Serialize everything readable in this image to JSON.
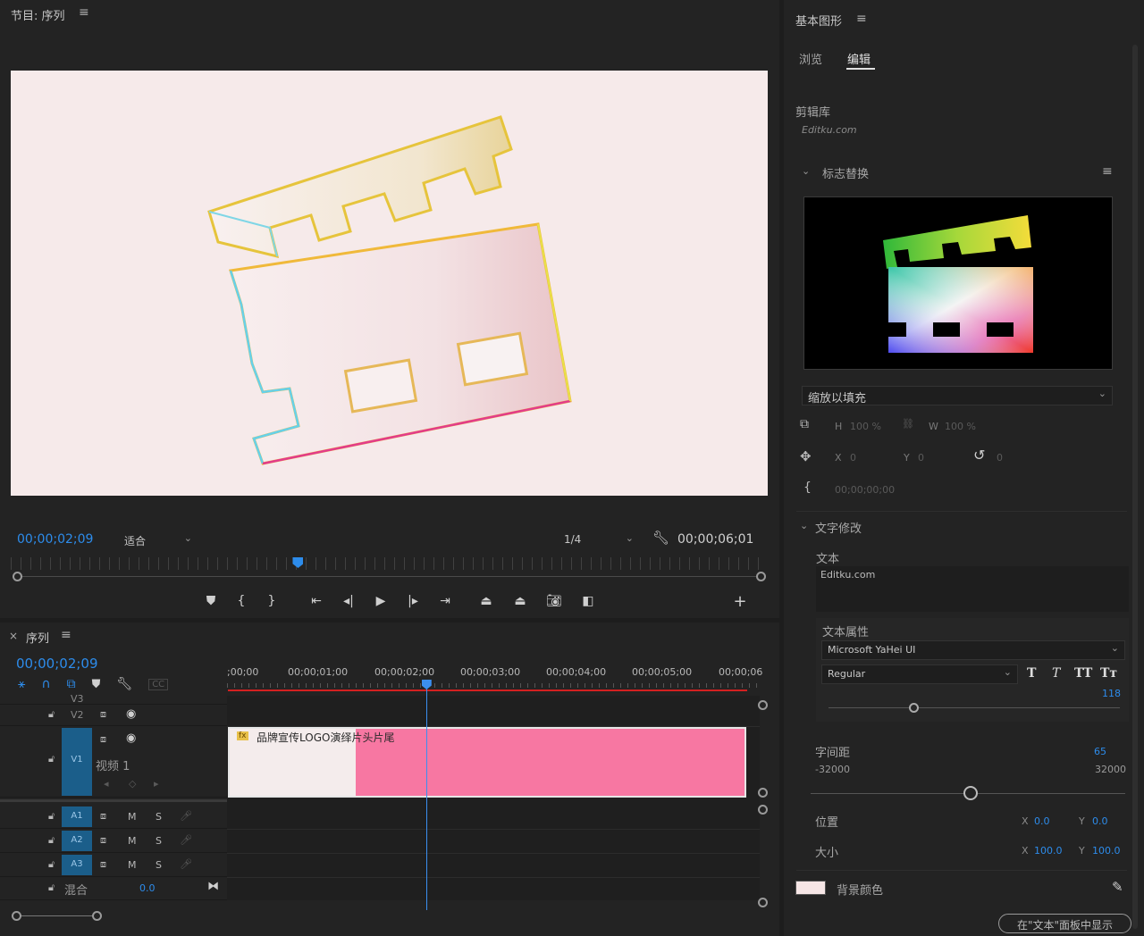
{
  "program": {
    "title": "节目: 序列",
    "timecode": "00;00;02;09",
    "fit": "适合",
    "resolution": "1/4",
    "duration": "00;00;06;01",
    "playhead_fraction": 0.38
  },
  "sequence": {
    "tab_title": "序列",
    "timecode": "00;00;02;09",
    "ruler": [
      ";00;00",
      "00;00;01;00",
      "00;00;02;00",
      "00;00;03;00",
      "00;00;04;00",
      "00;00;05;00",
      "00;00;06"
    ],
    "tracks": {
      "v3": "V3",
      "v2": "V2",
      "v1": "V1",
      "v1_name": "视频 1",
      "a1": "A1",
      "a2": "A2",
      "a3": "A3",
      "mute": "M",
      "solo": "S",
      "mix_label": "混合",
      "mix_value": "0.0"
    },
    "clip": {
      "fx": "fx",
      "name": "品牌宣传LOGO演绎片头片尾"
    },
    "cc_label": "CC"
  },
  "egp": {
    "title": "基本图形",
    "tabs": {
      "browse": "浏览",
      "edit": "编辑"
    },
    "library_label": "剪辑库",
    "library_value": "Editku.com",
    "section_logo": "标志替换",
    "scale_mode": "缩放以填充",
    "h_label": "H",
    "h_value": "100 %",
    "w_label": "W",
    "w_value": "100 %",
    "x_label": "X",
    "x_value": "0",
    "y_label": "Y",
    "y_value": "0",
    "rot_value": "0",
    "time_value": "00;00;00;00",
    "section_text": "文字修改",
    "text_label": "文本",
    "text_value": "Editku.com",
    "text_props_label": "文本属性",
    "font_family": "Microsoft YaHei UI",
    "font_style": "Regular",
    "font_size_value": "118",
    "tracking_label": "字间距",
    "tracking_value": "65",
    "tracking_min": "-32000",
    "tracking_max": "32000",
    "position_label": "位置",
    "pos_x_label": "X",
    "pos_x_value": "0.0",
    "pos_y_label": "Y",
    "pos_y_value": "0.0",
    "size_label": "大小",
    "size_x_label": "X",
    "size_x_value": "100.0",
    "size_y_label": "Y",
    "size_y_value": "100.0",
    "bg_color_label": "背景颜色",
    "bg_color": "#f6e6e6",
    "footer_button": "在\"文本\"面板中显示"
  },
  "colors": {
    "accent": "#2d8ceb",
    "clip_pink": "#f777a2",
    "track_blue": "#1b5e8a",
    "playhead_line": "#3b8ff0",
    "work_area_red": "#d42020"
  }
}
